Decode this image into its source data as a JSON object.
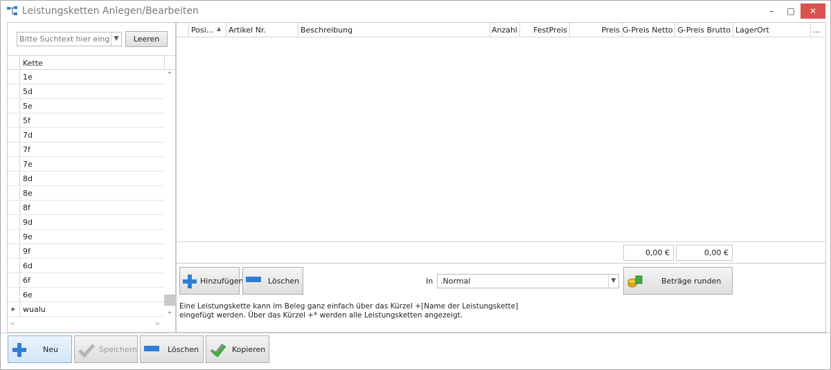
{
  "window": {
    "title": "Leistungsketten Anlegen/Bearbeiten",
    "controls": {
      "minimize": "–",
      "maximize": "□",
      "close": "✕"
    }
  },
  "search": {
    "placeholder": "Bitte Suchtext hier eingeben",
    "clear_label": "Leeren"
  },
  "kette_list": {
    "column": "Kette",
    "items": [
      "1e",
      "5d",
      "5e",
      "5f",
      "7d",
      "7f",
      "7e",
      "8d",
      "8e",
      "8f",
      "9d",
      "9e",
      "9f",
      "6d",
      "6f",
      "6e",
      "wualu"
    ],
    "current_row_marker": "▶"
  },
  "grid": {
    "columns": [
      "Posi...",
      "Artikel Nr.",
      "Beschreibung",
      "Anzahl",
      "FestPreis",
      "Preis",
      "G-Preis Netto",
      "G-Preis Brutto",
      "LagerOrt",
      "..."
    ],
    "sort_indicator": "▲",
    "totals": {
      "netto": "0,00 €",
      "brutto": "0,00 €"
    }
  },
  "actions": {
    "add_label": "Hinzufügen",
    "delete_label": "Löschen",
    "in_label": "In",
    "in_value": ".Normal",
    "round_label": "Beträge runden"
  },
  "info": {
    "line1": "Eine Leistungskette kann im Beleg ganz einfach über das Kürzel +[Name der Leistungskette]",
    "line2": "eingefügt werden. Über das Kürzel +*  werden alle Leistungsketten angezeigt."
  },
  "toolbar": {
    "new_label": "Neu",
    "save_label": "Speichern",
    "delete_label": "Löschen",
    "copy_label": "Kopieren"
  },
  "colors": {
    "accent_blue": "#2e7fd6",
    "close_red": "#d9534f",
    "check_green": "#3fae3f"
  }
}
